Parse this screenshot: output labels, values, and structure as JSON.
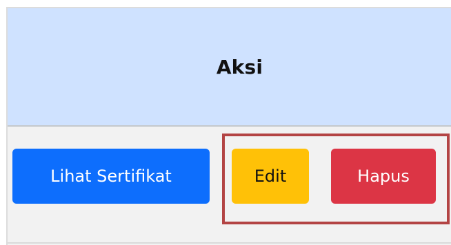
{
  "table": {
    "header": "Aksi"
  },
  "actions": {
    "view_label": "Lihat Sertifikat",
    "edit_label": "Edit",
    "delete_label": "Hapus"
  },
  "colors": {
    "header_bg": "#cfe2ff",
    "view_button": "#0d6efd",
    "edit_button": "#ffc107",
    "delete_button": "#dc3545",
    "highlight_border": "#b34444"
  }
}
